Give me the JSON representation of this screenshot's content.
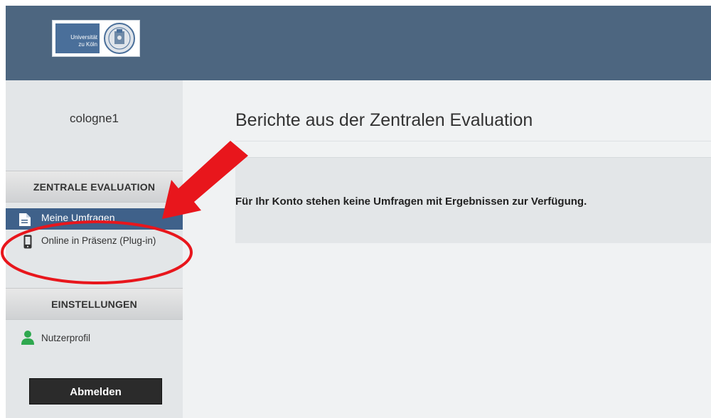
{
  "header": {
    "logo_line1": "Universität",
    "logo_line2": "zu Köln",
    "background": "#4d6680"
  },
  "sidebar": {
    "username": "cologne1",
    "section_zentrale": "ZENTRALE EVALUATION",
    "items_zentrale": [
      {
        "label": "Meine Umfragen",
        "icon": "document-icon",
        "active": true
      },
      {
        "label": "Online in Präsenz (Plug-in)",
        "icon": "mobile-device-icon",
        "active": false
      }
    ],
    "section_einstellungen": "EINSTELLUNGEN",
    "items_einstellungen": [
      {
        "label": "Nutzerprofil",
        "icon": "user-icon",
        "active": false
      }
    ],
    "logout_label": "Abmelden"
  },
  "main": {
    "title": "Berichte aus der Zentralen Evaluation",
    "notice": "Für Ihr Konto stehen keine Umfragen mit Ergebnissen zur Verfügung."
  },
  "annotation": {
    "arrow_color": "#e8161c",
    "ellipse_color": "#e8161c"
  },
  "colors": {
    "active_item": "#3f618a",
    "logout_button": "#2b2b2b"
  }
}
